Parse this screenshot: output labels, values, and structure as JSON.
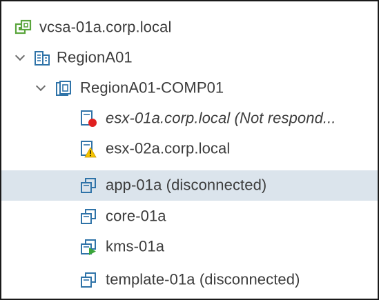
{
  "tree": {
    "items": [
      {
        "label": "vcsa-01a.corp.local",
        "icon": "vcenter-icon",
        "italic": false,
        "expanded": null,
        "selected": false
      },
      {
        "label": "RegionA01",
        "icon": "datacenter-icon",
        "italic": false,
        "expanded": true,
        "selected": false
      },
      {
        "label": "RegionA01-COMP01",
        "icon": "cluster-icon",
        "italic": false,
        "expanded": true,
        "selected": false
      },
      {
        "label": "esx-01a.corp.local (Not respond...",
        "icon": "host-error-icon",
        "italic": true,
        "expanded": null,
        "selected": false
      },
      {
        "label": "esx-02a.corp.local",
        "icon": "host-warning-icon",
        "italic": false,
        "expanded": null,
        "selected": false
      },
      {
        "label": "app-01a (disconnected)",
        "icon": "vm-icon",
        "italic": false,
        "expanded": null,
        "selected": true
      },
      {
        "label": "core-01a",
        "icon": "vm-icon",
        "italic": false,
        "expanded": null,
        "selected": false
      },
      {
        "label": "kms-01a",
        "icon": "vm-powered-on-icon",
        "italic": false,
        "expanded": null,
        "selected": false
      },
      {
        "label": "template-01a (disconnected)",
        "icon": "vm-icon",
        "italic": false,
        "expanded": null,
        "selected": false
      }
    ]
  },
  "colors": {
    "selection": "#dbe4ec",
    "icon_blue": "#2f73a8",
    "vcenter_green": "#5aa53c",
    "error_red": "#e02020",
    "warning_yellow": "#f5c400",
    "power_green": "#3aa63a"
  }
}
